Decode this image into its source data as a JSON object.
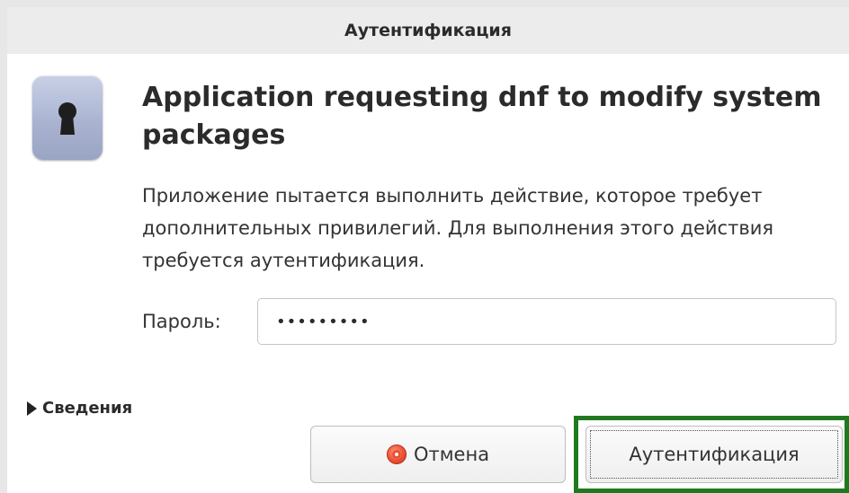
{
  "window": {
    "title": "Аутентификация"
  },
  "icons": {
    "dialog_icon": "keyhole-lock-icon",
    "cancel_icon": "cancel-stop-icon",
    "expander_icon": "triangle-right-icon"
  },
  "dialog": {
    "heading": "Application requesting dnf to modify system packages",
    "message": "Приложение пытается выполнить действие, которое требует дополнительных привилегий. Для выполнения этого действия требуется аутентификация.",
    "password_label": "Пароль:",
    "password_value": "•••••••••",
    "details_label": "Сведения",
    "cancel_label": "Отмена",
    "authenticate_label": "Аутентификация"
  },
  "colors": {
    "focus_highlight": "#1f7a1f",
    "icon_tile": "#aab4d1",
    "cancel_icon": "#e94e32"
  }
}
